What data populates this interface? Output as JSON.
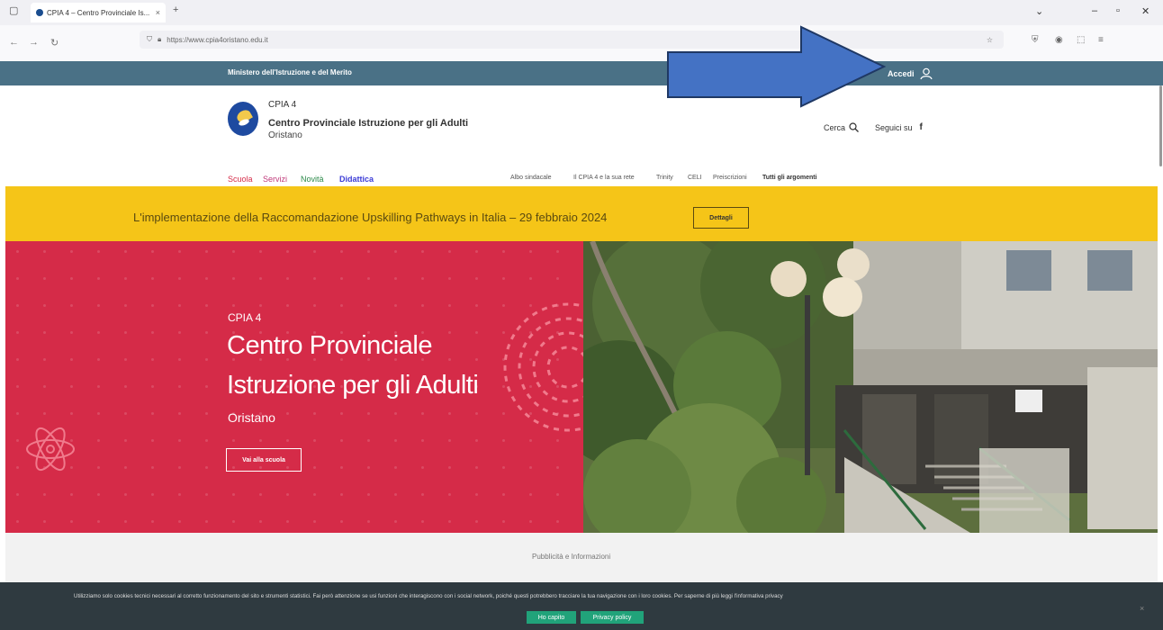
{
  "browser": {
    "tab_title": "CPIA 4 – Centro Provinciale Is...",
    "tab_close": "×",
    "new_tab": "+",
    "url": "https://www.cpia4oristano.edu.it"
  },
  "topbar": {
    "ministry": "Ministero dell'Istruzione e del Merito",
    "login": "Accedi"
  },
  "header": {
    "school_short": "CPIA 4",
    "school_name": "Centro Provinciale Istruzione per gli Adulti",
    "city": "Oristano",
    "search": "Cerca",
    "follow": "Seguici su"
  },
  "nav": {
    "main": [
      "Scuola",
      "Servizi",
      "Novità",
      "Didattica"
    ],
    "secondary": [
      "Albo sindacale",
      "Il CPIA 4 e la sua rete",
      "Trinity",
      "CELI",
      "Preiscrizioni",
      "Tutti gli argomenti"
    ]
  },
  "banner": {
    "text": "L'implementazione della Raccomandazione Upskilling Pathways in Italia – 29 febbraio 2024",
    "button": "Dettagli",
    "color": "#f5c518"
  },
  "hero": {
    "kicker": "CPIA 4",
    "title_line1": "Centro Provinciale",
    "title_line2": "Istruzione per gli Adulti",
    "city": "Oristano",
    "cta": "Vai alla scuola",
    "color": "#d52b48"
  },
  "info": {
    "label": "Pubblicità e Informazioni"
  },
  "cookie": {
    "message": "Utilizziamo solo cookies tecnici necessari al corretto funzionamento del sito e strumenti statistici. Fai però attenzione se usi funzioni che interagiscono con i social network, poiché questi potrebbero tracciare la tua navigazione con i loro cookies. Per saperne di più leggi l'informativa privacy",
    "accept": "Ho capito",
    "privacy": "Privacy policy",
    "close": "×"
  }
}
